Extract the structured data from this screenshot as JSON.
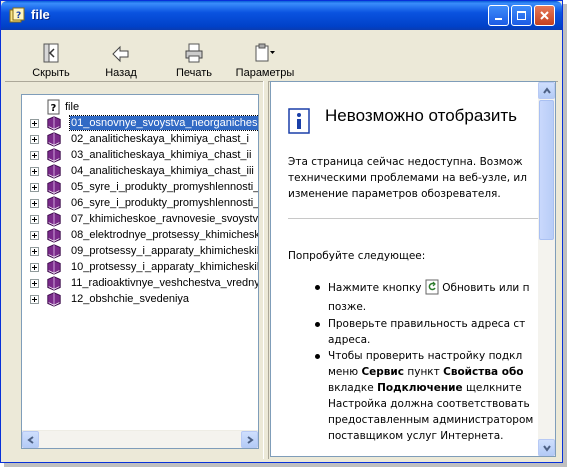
{
  "window": {
    "title": "file",
    "controls": {
      "minimize_icon": "minimize-icon",
      "maximize_icon": "maximize-icon",
      "close_icon": "close-icon"
    }
  },
  "toolbar": {
    "hide_label": "Скрыть",
    "back_label": "Назад",
    "print_label": "Печать",
    "options_label": "Параметры"
  },
  "tree": {
    "root_label": "file",
    "items": [
      {
        "label": "01_osnovnye_svoystva_neorganiches",
        "selected": true
      },
      {
        "label": "02_analiticheskaya_khimiya_chast_i"
      },
      {
        "label": "03_analiticheskaya_khimiya_chast_ii"
      },
      {
        "label": "04_analiticheskaya_khimiya_chast_iii"
      },
      {
        "label": "05_syre_i_produkty_promyshlennosti_c"
      },
      {
        "label": "06_syre_i_produkty_promyshlennosti_c"
      },
      {
        "label": "07_khimicheskoe_ravnovesie_svoystv"
      },
      {
        "label": "08_elektrodnye_protsessy_khimichesk"
      },
      {
        "label": "09_protsessy_i_apparaty_khimicheskik"
      },
      {
        "label": "10_protsessy_i_apparaty_khimicheskik"
      },
      {
        "label": "11_radioaktivnye_veshchestva_vredny"
      },
      {
        "label": "12_obshchie_svedeniya"
      }
    ]
  },
  "content": {
    "error_title": "Невозможно отобразить",
    "intro_lines": [
      "Эта страница сейчас недоступна. Возмож",
      "техническими проблемами на веб-узле, ил",
      "изменение параметров обозревателя."
    ],
    "try_label": "Попробуйте следующее:",
    "bullet1_pre": "Нажмите кнопку",
    "bullet1_post": "Обновить или п",
    "bullet1_line2": "позже.",
    "bullet2_line1": "Проверьте правильность адреса ст",
    "bullet2_line2": "адреса.",
    "bullet3_line1": "Чтобы проверить настройку подкл",
    "bullet3_line2_pre": "меню",
    "bullet3_line2_bold1": "Сервис",
    "bullet3_line2_mid": "пункт",
    "bullet3_line2_bold2": "Свойства обо",
    "bullet3_line3_pre": "вкладке",
    "bullet3_line3_bold": "Подключение",
    "bullet3_line3_post": "щелкните",
    "bullet3_line4": "Настройка должна соответствовать",
    "bullet3_line5": "предоставленным администратором",
    "bullet3_line6": "поставщиком услуг Интернета."
  },
  "colors": {
    "titlebar": "#0a53e0",
    "selection": "#316ac5",
    "chrome": "#ece9d8"
  }
}
